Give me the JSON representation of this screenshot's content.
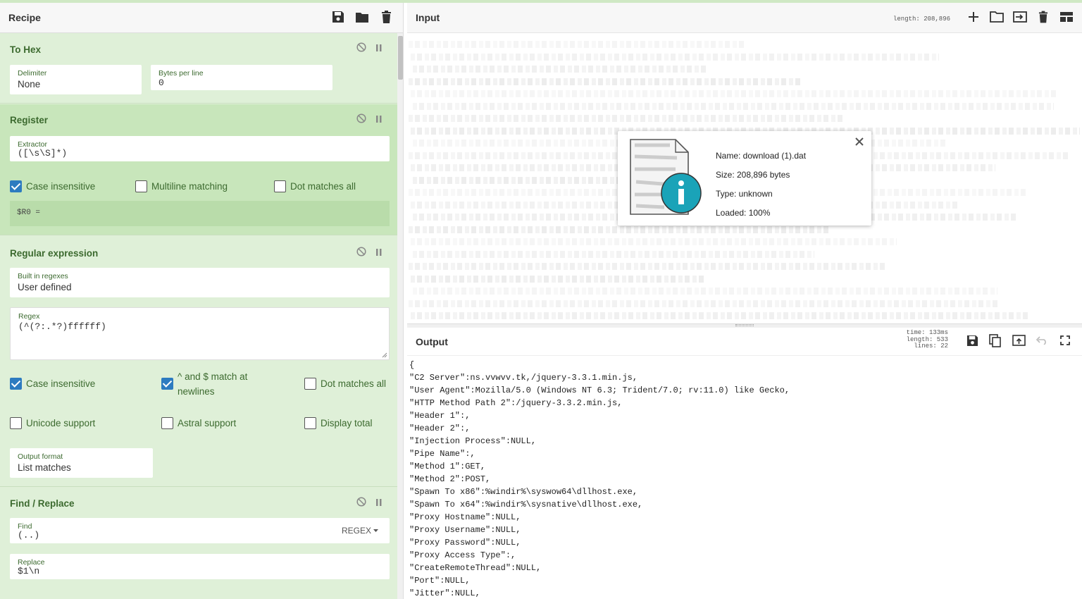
{
  "recipe": {
    "title": "Recipe",
    "operations": [
      {
        "title": "To Hex",
        "fields": [
          {
            "label": "Delimiter",
            "value": "None"
          },
          {
            "label": "Bytes per line",
            "value": "0"
          }
        ]
      },
      {
        "title": "Register",
        "fields": [
          {
            "label": "Extractor",
            "value": "([\\s\\S]*)"
          }
        ],
        "checkboxes": [
          {
            "label": "Case insensitive",
            "checked": true
          },
          {
            "label": "Multiline matching",
            "checked": false
          },
          {
            "label": "Dot matches all",
            "checked": false
          }
        ],
        "output": "$R0 ="
      },
      {
        "title": "Regular expression",
        "fields": [
          {
            "label": "Built in regexes",
            "value": "User defined"
          },
          {
            "label": "Regex",
            "value": "(^(?:.*?)ffffff)"
          },
          {
            "label": "Output format",
            "value": "List matches"
          }
        ],
        "checkboxes": [
          {
            "label": "Case insensitive",
            "checked": true
          },
          {
            "label": "^ and $ match at",
            "label2": "newlines",
            "checked": true
          },
          {
            "label": "Dot matches all",
            "checked": false
          },
          {
            "label": "Unicode support",
            "checked": false
          },
          {
            "label": "Astral support",
            "checked": false
          },
          {
            "label": "Display total",
            "checked": false
          }
        ]
      },
      {
        "title": "Find / Replace",
        "fields": [
          {
            "label": "Find",
            "value": "(..)",
            "mode": "REGEX"
          },
          {
            "label": "Replace",
            "value": "$1\\n"
          }
        ]
      }
    ]
  },
  "input": {
    "title": "Input",
    "length_label": "length: 208,896",
    "file": {
      "name": "Name: download (1).dat",
      "size": "Size: 208,896 bytes",
      "type": "Type: unknown",
      "loaded": "Loaded: 100%"
    }
  },
  "output": {
    "title": "Output",
    "time": "time: 133ms",
    "length": "length:  533",
    "lines_count": "lines:   22",
    "lines": [
      "{",
      "\"C2 Server\":ns.vvwvv.tk,/jquery-3.3.1.min.js,",
      "\"User Agent\":Mozilla/5.0 (Windows NT 6.3; Trident/7.0; rv:11.0) like Gecko,",
      "\"HTTP Method Path 2\":/jquery-3.3.2.min.js,",
      "\"Header 1\":,",
      "\"Header 2\":,",
      "\"Injection Process\":NULL,",
      "\"Pipe Name\":,",
      "\"Method 1\":GET,",
      "\"Method 2\":POST,",
      "\"Spawn To x86\":%windir%\\syswow64\\dllhost.exe,",
      "\"Spawn To x64\":%windir%\\sysnative\\dllhost.exe,",
      "\"Proxy Hostname\":NULL,",
      "\"Proxy Username\":NULL,",
      "\"Proxy Password\":NULL,",
      "\"Proxy Access Type\":,",
      "\"CreateRemoteThread\":NULL,",
      "\"Port\":NULL,",
      "\"Jitter\":NULL,"
    ]
  },
  "colors": {
    "accent": "#3c6a2f",
    "op_bg": "#dff0d8",
    "checkbox_on": "#2d7bc0"
  }
}
